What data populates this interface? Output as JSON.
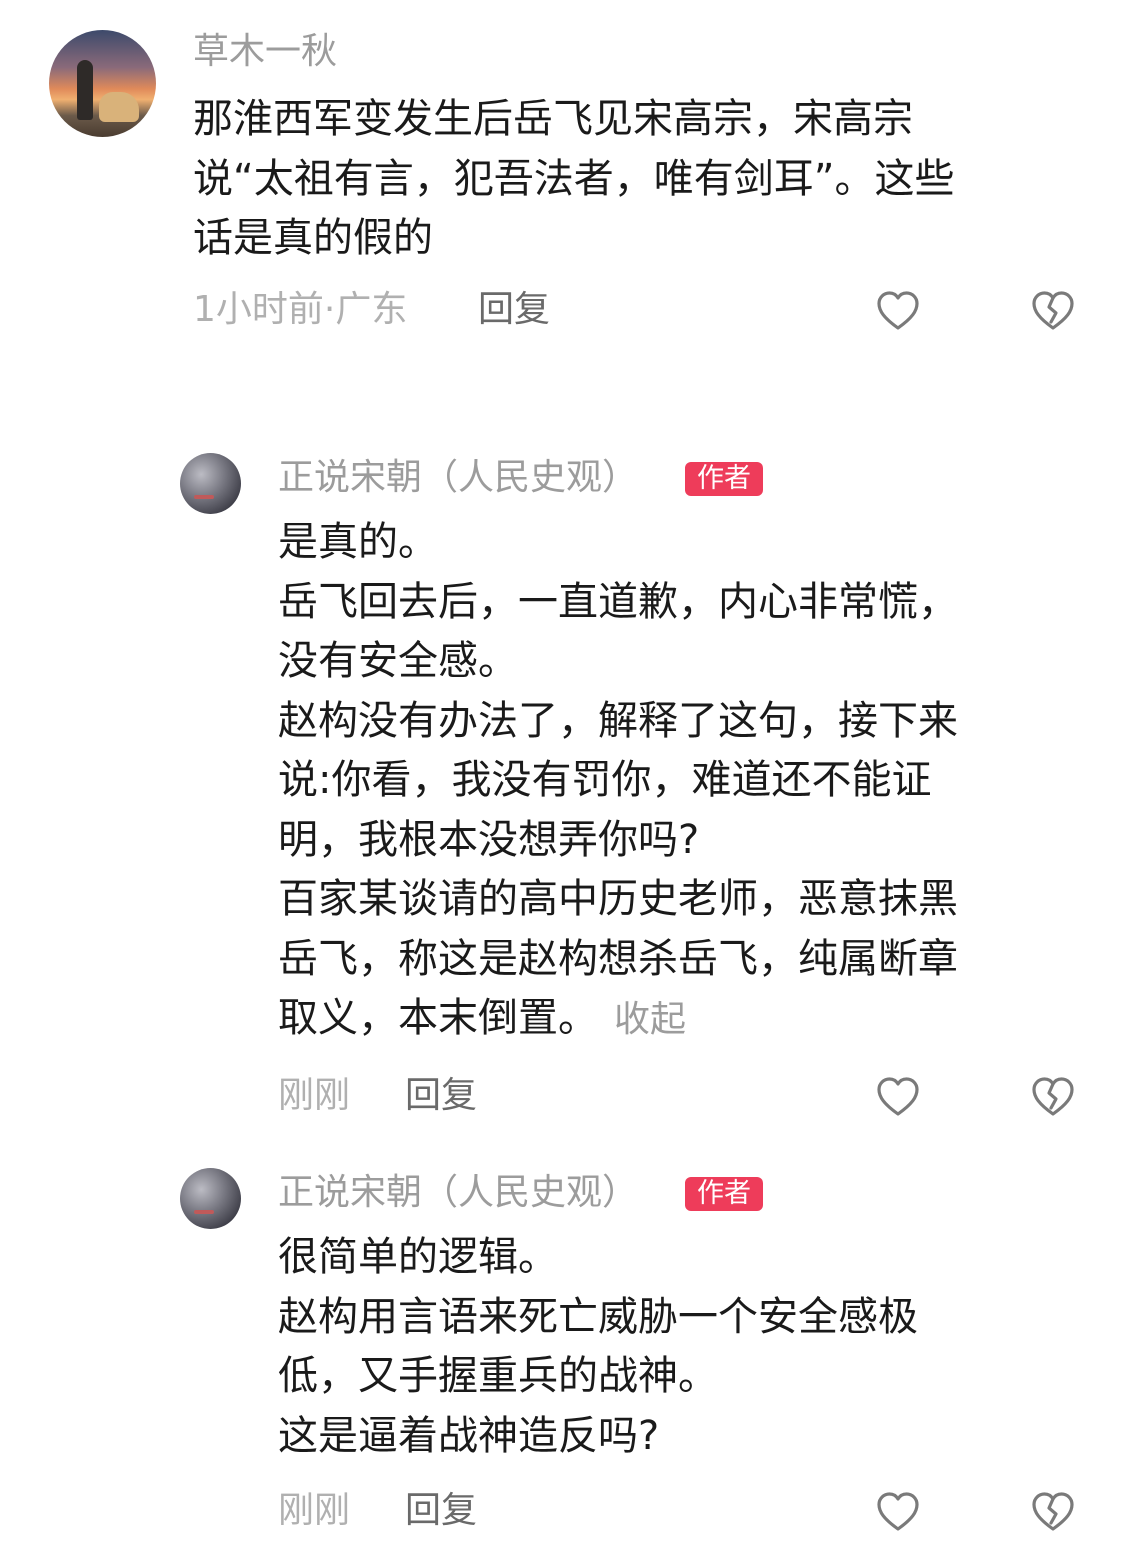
{
  "comments": [
    {
      "username": "草木一秋",
      "lines": [
        "那淮西军变发生后岳飞见宋高宗，宋高宗",
        "说“太祖有言，犯吾法者，唯有剑耳”。这些",
        "话是真的假的"
      ],
      "meta": "1小时前·广东",
      "reply_label": "回复",
      "like_icon": "heart-outline-icon",
      "dislike_icon": "broken-heart-icon"
    },
    {
      "username": "正说宋朝（人民史观）",
      "badge": "作者",
      "lines": [
        "是真的。",
        "岳飞回去后，一直道歉，内心非常慌，",
        "没有安全感。",
        "赵构没有办法了，解释了这句，接下来",
        "说:你看，我没有罚你，难道还不能证",
        "明，我根本没想弄你吗?",
        "百家某谈请的高中历史老师，恶意抹黑",
        "岳飞，称这是赵构想杀岳飞，纯属断章",
        "取义，本末倒置。"
      ],
      "collapse_label": "收起",
      "meta": "刚刚",
      "reply_label": "回复",
      "like_icon": "heart-outline-icon",
      "dislike_icon": "broken-heart-icon"
    },
    {
      "username": "正说宋朝（人民史观）",
      "badge": "作者",
      "lines": [
        "很简单的逻辑。",
        "赵构用言语来死亡威胁一个安全感极",
        "低，又手握重兵的战神。",
        "这是逼着战神造反吗?"
      ],
      "meta": "刚刚",
      "reply_label": "回复",
      "like_icon": "heart-outline-icon",
      "dislike_icon": "broken-heart-icon"
    }
  ],
  "colors": {
    "badge_bg": "#ee3c5a",
    "username": "#9c9c9c",
    "meta": "#b0b0b0",
    "text": "#1a1a1a"
  }
}
